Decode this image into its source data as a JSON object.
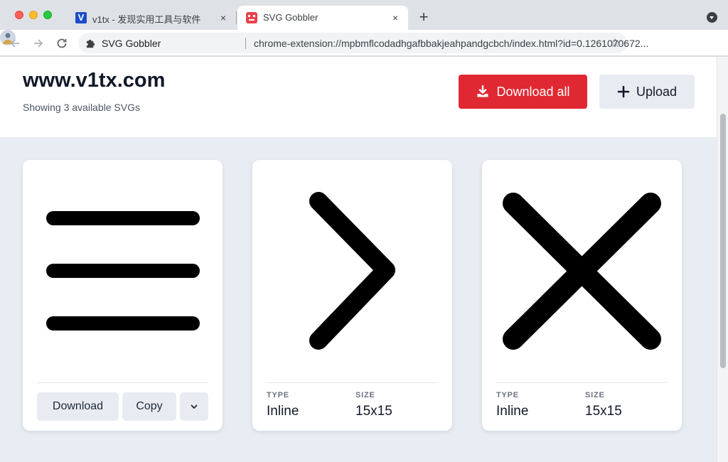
{
  "browser": {
    "tabs": [
      {
        "title": "v1tx - 发现实用工具与软件",
        "favicon_letter": "V",
        "active": false,
        "close": "×"
      },
      {
        "title": "SVG Gobbler",
        "active": true,
        "close": "×"
      }
    ],
    "new_tab": "+",
    "address": {
      "site_name": "SVG Gobbler",
      "url": "chrome-extension://mpbmflcodadhgafbbakjeahpandgcbch/index.html?id=0.1261070672..."
    },
    "colors": {
      "accent_red": "#e02832",
      "page_bg": "#e8edf3"
    }
  },
  "page": {
    "title": "www.v1tx.com",
    "subtitle": "Showing 3 available SVGs",
    "download_all_label": "Download all",
    "upload_label": "Upload"
  },
  "cards": [
    {
      "icon": "hamburger-menu-icon",
      "download_label": "Download",
      "copy_label": "Copy"
    },
    {
      "icon": "chevron-right-icon",
      "type_label": "TYPE",
      "type_value": "Inline",
      "size_label": "SIZE",
      "size_value": "15x15"
    },
    {
      "icon": "close-x-icon",
      "type_label": "TYPE",
      "type_value": "Inline",
      "size_label": "SIZE",
      "size_value": "15x15"
    }
  ]
}
